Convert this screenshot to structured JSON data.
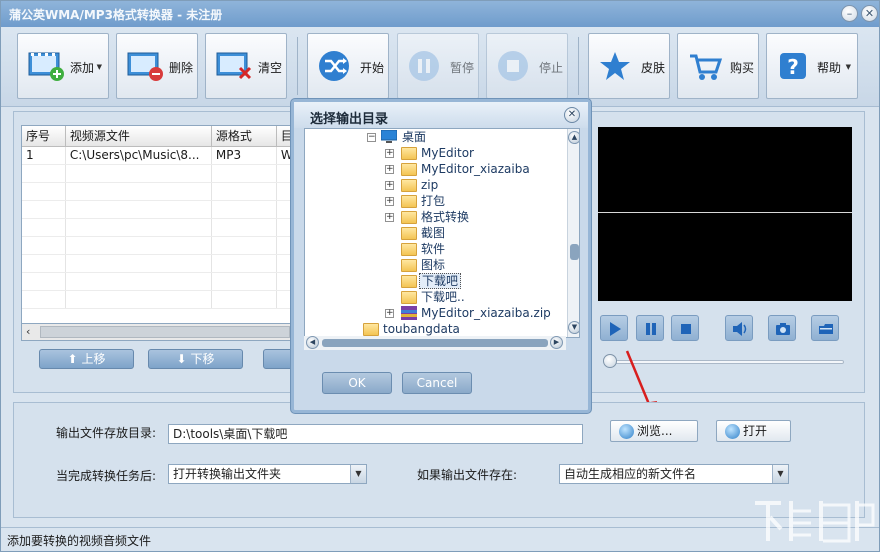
{
  "window": {
    "title": "蒲公英WMA/MP3格式转换器 - 未注册",
    "minimize_glyph": "–",
    "close_glyph": "✕"
  },
  "toolbar": {
    "add_label": "添加",
    "delete_label": "删除",
    "clear_label": "清空",
    "start_label": "开始",
    "pause_label": "暂停",
    "stop_label": "停止",
    "skin_label": "皮肤",
    "buy_label": "购买",
    "help_label": "帮助",
    "dropdown_glyph": "▼"
  },
  "filelist": {
    "columns": [
      "序号",
      "视频源文件",
      "源格式",
      "目标格式"
    ],
    "rows": [
      {
        "index": "1",
        "file": "C:\\Users\\pc\\Music\\8...",
        "src": "MP3",
        "dst": "WMA"
      }
    ],
    "scroll_left_glyph": "‹"
  },
  "list_buttons": {
    "up_label": "上移",
    "down_label": "下移"
  },
  "dialog": {
    "title": "选择输出目录",
    "close_glyph": "✕",
    "tree": [
      {
        "label": "桌面",
        "expander": "−",
        "type": "desktop"
      },
      {
        "label": "MyEditor",
        "expander": "+",
        "type": "folder"
      },
      {
        "label": "MyEditor_xiazaiba",
        "expander": "+",
        "type": "folder"
      },
      {
        "label": "zip",
        "expander": "+",
        "type": "folder"
      },
      {
        "label": "打包",
        "expander": "+",
        "type": "folder"
      },
      {
        "label": "格式转换",
        "expander": "+",
        "type": "folder"
      },
      {
        "label": "截图",
        "expander": "",
        "type": "folder"
      },
      {
        "label": "软件",
        "expander": "",
        "type": "folder"
      },
      {
        "label": "图标",
        "expander": "",
        "type": "folder"
      },
      {
        "label": "下载吧",
        "expander": "",
        "type": "folder",
        "selected": true
      },
      {
        "label": "下载吧..",
        "expander": "",
        "type": "folder"
      },
      {
        "label": "MyEditor_xiazaiba.zip",
        "expander": "+",
        "type": "zip"
      },
      {
        "label": "toubangdata",
        "expander": "",
        "type": "folder"
      }
    ],
    "ok_label": "OK",
    "cancel_label": "Cancel",
    "scroll_up_glyph": "▲",
    "scroll_down_glyph": "▼",
    "scroll_left_glyph": "◀",
    "scroll_right_glyph": "▶"
  },
  "settings": {
    "output_dir_label": "输出文件存放目录:",
    "output_dir_value": "D:\\tools\\桌面\\下载吧",
    "browse_label": "浏览...",
    "open_label": "打开",
    "after_task_label": "当完成转换任务后:",
    "after_task_value": "打开转换输出文件夹",
    "if_exists_label": "如果输出文件存在:",
    "if_exists_value": "自动生成相应的新文件名",
    "dropdown_glyph": "▼"
  },
  "statusbar": {
    "text": "添加要转换的视频音频文件"
  },
  "colors": {
    "accent": "#2f7fd0",
    "arrow": "#d81e1e",
    "preview_bg": "#000000"
  }
}
